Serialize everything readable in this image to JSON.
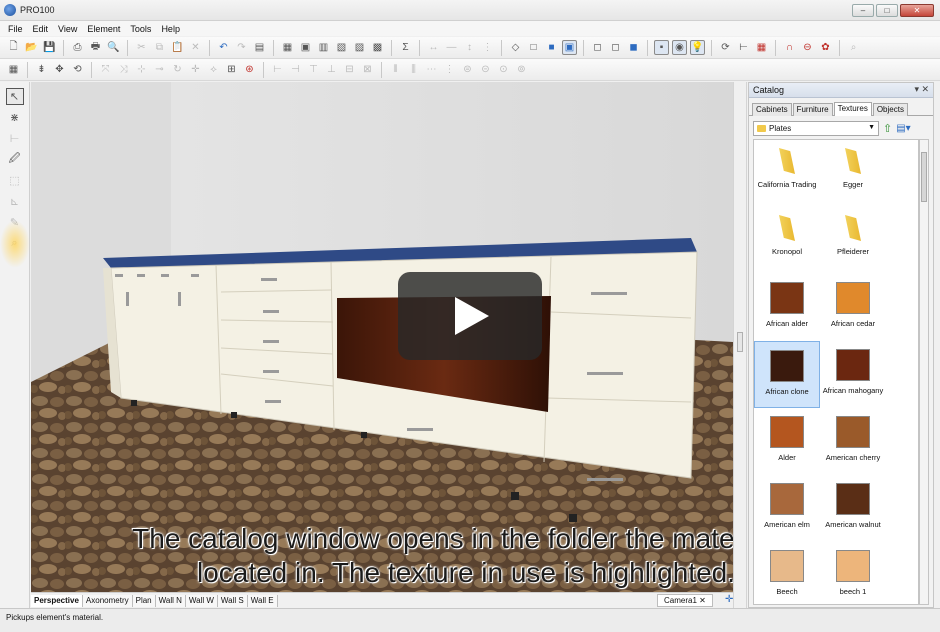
{
  "window": {
    "title": "PRO100",
    "controls": [
      "–",
      "□",
      "✕"
    ]
  },
  "menu": [
    "File",
    "Edit",
    "View",
    "Element",
    "Tools",
    "Help"
  ],
  "toolbar1": [
    {
      "name": "new-icon",
      "glyph": "🗋",
      "cls": ""
    },
    {
      "name": "open-icon",
      "glyph": "📂",
      "cls": ""
    },
    {
      "name": "save-icon",
      "glyph": "💾",
      "cls": ""
    },
    {
      "sep": true
    },
    {
      "name": "print-preview-icon",
      "glyph": "⎙",
      "cls": ""
    },
    {
      "name": "print-icon",
      "glyph": "🖶",
      "cls": ""
    },
    {
      "name": "find-icon",
      "glyph": "🔍",
      "cls": ""
    },
    {
      "sep": true
    },
    {
      "name": "cut-icon",
      "glyph": "✂",
      "cls": "dim"
    },
    {
      "name": "copy-icon",
      "glyph": "⧉",
      "cls": "dim"
    },
    {
      "name": "paste-icon",
      "glyph": "📋",
      "cls": "dim"
    },
    {
      "name": "delete-icon",
      "glyph": "✕",
      "cls": "dim"
    },
    {
      "sep": true
    },
    {
      "name": "undo-icon",
      "glyph": "↶",
      "cls": "blue"
    },
    {
      "name": "redo-icon",
      "glyph": "↷",
      "cls": "dim"
    },
    {
      "name": "properties-icon",
      "glyph": "▤",
      "cls": ""
    },
    {
      "sep": true
    },
    {
      "name": "view1-icon",
      "glyph": "▦",
      "cls": ""
    },
    {
      "name": "view2-icon",
      "glyph": "▣",
      "cls": ""
    },
    {
      "name": "view3-icon",
      "glyph": "▥",
      "cls": ""
    },
    {
      "name": "view4-icon",
      "glyph": "▧",
      "cls": ""
    },
    {
      "name": "view5-icon",
      "glyph": "▨",
      "cls": ""
    },
    {
      "name": "view6-icon",
      "glyph": "▩",
      "cls": ""
    },
    {
      "sep": true
    },
    {
      "name": "sum-icon",
      "glyph": "Σ",
      "cls": ""
    },
    {
      "sep": true
    },
    {
      "name": "dim-horizontal-icon",
      "glyph": "↔",
      "cls": "dim"
    },
    {
      "name": "dim-line-icon",
      "glyph": "—",
      "cls": "dim"
    },
    {
      "name": "dim-vertical-icon",
      "glyph": "↕",
      "cls": "dim"
    },
    {
      "name": "dim-stack-icon",
      "glyph": "⋮",
      "cls": "dim"
    },
    {
      "sep": true
    },
    {
      "name": "cube-wire-icon",
      "glyph": "◇",
      "cls": ""
    },
    {
      "name": "cube-outline-icon",
      "glyph": "□",
      "cls": ""
    },
    {
      "name": "cube-solid-icon",
      "glyph": "■",
      "cls": "blue"
    },
    {
      "name": "cube-render-icon",
      "glyph": "▣",
      "cls": "boxed blue"
    },
    {
      "sep": true
    },
    {
      "name": "box1-icon",
      "glyph": "◻",
      "cls": ""
    },
    {
      "name": "box2-icon",
      "glyph": "◻",
      "cls": ""
    },
    {
      "name": "box3-icon",
      "glyph": "◼",
      "cls": "blue"
    },
    {
      "sep": true
    },
    {
      "name": "render-mode-icon",
      "glyph": "▪",
      "cls": "boxed"
    },
    {
      "name": "texture-mode-icon",
      "glyph": "◉",
      "cls": "boxed"
    },
    {
      "name": "light-icon",
      "glyph": "💡",
      "cls": "boxed"
    },
    {
      "sep": true
    },
    {
      "name": "rotate-icon",
      "glyph": "⟳",
      "cls": ""
    },
    {
      "name": "measure-icon",
      "glyph": "⊢",
      "cls": ""
    },
    {
      "name": "grid-icon",
      "glyph": "▦",
      "cls": "red"
    },
    {
      "sep": true
    },
    {
      "name": "magnet-icon",
      "glyph": "∩",
      "cls": "red"
    },
    {
      "name": "stop-icon",
      "glyph": "⊖",
      "cls": "red"
    },
    {
      "name": "settings-icon",
      "glyph": "✿",
      "cls": "red"
    },
    {
      "sep": true
    },
    {
      "name": "zoom-icon",
      "glyph": "⌕",
      "cls": "dim"
    }
  ],
  "toolbar2": [
    {
      "name": "grid-snap-icon",
      "glyph": "▦",
      "cls": ""
    },
    {
      "sep": true
    },
    {
      "name": "align-icon",
      "glyph": "⇟",
      "cls": ""
    },
    {
      "name": "move-icon",
      "glyph": "✥",
      "cls": ""
    },
    {
      "name": "rotate-tool-icon",
      "glyph": "⟲",
      "cls": ""
    },
    {
      "sep": true
    },
    {
      "name": "tool-a-icon",
      "glyph": "⤧",
      "cls": "dim"
    },
    {
      "name": "tool-b-icon",
      "glyph": "⤨",
      "cls": "dim"
    },
    {
      "name": "tool-c-icon",
      "glyph": "⊹",
      "cls": "dim"
    },
    {
      "name": "tool-d-icon",
      "glyph": "⊸",
      "cls": "dim"
    },
    {
      "name": "tool-e-icon",
      "glyph": "↻",
      "cls": "dim"
    },
    {
      "name": "tool-f-icon",
      "glyph": "✛",
      "cls": "dim"
    },
    {
      "name": "tool-g-icon",
      "glyph": "⟡",
      "cls": "dim"
    },
    {
      "name": "tool-h-icon",
      "glyph": "⊞",
      "cls": ""
    },
    {
      "name": "tool-i-icon",
      "glyph": "⊛",
      "cls": "red"
    },
    {
      "sep": true
    },
    {
      "name": "align1-icon",
      "glyph": "⊢",
      "cls": "dim"
    },
    {
      "name": "align2-icon",
      "glyph": "⊣",
      "cls": "dim"
    },
    {
      "name": "align3-icon",
      "glyph": "⊤",
      "cls": "dim"
    },
    {
      "name": "align4-icon",
      "glyph": "⊥",
      "cls": "dim"
    },
    {
      "name": "align5-icon",
      "glyph": "⊟",
      "cls": "dim"
    },
    {
      "name": "align6-icon",
      "glyph": "⊠",
      "cls": "dim"
    },
    {
      "sep": true
    },
    {
      "name": "dist1-icon",
      "glyph": "⫴",
      "cls": "dim"
    },
    {
      "name": "dist2-icon",
      "glyph": "⫼",
      "cls": "dim"
    },
    {
      "name": "dist3-icon",
      "glyph": "⋯",
      "cls": "dim"
    },
    {
      "name": "dist4-icon",
      "glyph": "⋮",
      "cls": "dim"
    },
    {
      "name": "dist5-icon",
      "glyph": "⊜",
      "cls": "dim"
    },
    {
      "name": "dist6-icon",
      "glyph": "⊝",
      "cls": "dim"
    },
    {
      "name": "dist7-icon",
      "glyph": "⊙",
      "cls": "dim"
    },
    {
      "name": "dist8-icon",
      "glyph": "⊚",
      "cls": "dim"
    }
  ],
  "lefttools": [
    {
      "name": "select-tool-icon",
      "glyph": "↖",
      "cls": "active"
    },
    {
      "name": "snap-tool-icon",
      "glyph": "⋇",
      "cls": ""
    },
    {
      "name": "dimension-tool-icon",
      "glyph": "⊢",
      "cls": "dim"
    },
    {
      "name": "pickup-material-tool-icon",
      "glyph": "🖉",
      "cls": ""
    },
    {
      "name": "paint-tool-icon",
      "glyph": "⬚",
      "cls": "dim"
    },
    {
      "name": "measure-tool-icon",
      "glyph": "⊾",
      "cls": "dim"
    },
    {
      "name": "edit-tool-icon",
      "glyph": "✎",
      "cls": "dim"
    },
    {
      "name": "zoom-tool-icon",
      "glyph": "⌕",
      "cls": "dim"
    }
  ],
  "viewport": {
    "caption_line1": "The catalog window opens in the folder the material is",
    "caption_line2": "located in. The texture in use  is highlighted."
  },
  "view_tabs": [
    "Perspective",
    "Axonometry",
    "Plan",
    "Wall N",
    "Wall W",
    "Wall S",
    "Wall E"
  ],
  "active_view_tab": "Perspective",
  "document_tab": "Camera1  ✕",
  "status_text": "Pickups element's material.",
  "catalog": {
    "title": "Catalog",
    "header_controls": "▾ ✕",
    "tabs": [
      "Cabinets",
      "Furniture",
      "Textures",
      "Objects"
    ],
    "active_tab": "Textures",
    "path": "Plates",
    "items": [
      {
        "label": "California Trading",
        "kind": "folder",
        "color": ""
      },
      {
        "label": "Egger",
        "kind": "folder",
        "color": ""
      },
      {
        "label": "Kronopol",
        "kind": "folder",
        "color": ""
      },
      {
        "label": "Pfleiderer",
        "kind": "folder",
        "color": ""
      },
      {
        "label": "African alder",
        "kind": "texture",
        "color": "#7a3514"
      },
      {
        "label": "African cedar",
        "kind": "texture",
        "color": "#e0892c"
      },
      {
        "label": "African clone",
        "kind": "texture",
        "color": "#3a1a0d",
        "selected": true
      },
      {
        "label": "African mahogany",
        "kind": "texture",
        "color": "#6b2710"
      },
      {
        "label": "Alder",
        "kind": "texture",
        "color": "#b4561f"
      },
      {
        "label": "American cherry",
        "kind": "texture",
        "color": "#9a5a2a"
      },
      {
        "label": "American elm",
        "kind": "texture",
        "color": "#a8683c"
      },
      {
        "label": "American walnut",
        "kind": "texture",
        "color": "#5a2e16"
      },
      {
        "label": "Beech",
        "kind": "texture",
        "color": "#e7b98a"
      },
      {
        "label": "beech 1",
        "kind": "texture",
        "color": "#edb57b"
      }
    ]
  }
}
